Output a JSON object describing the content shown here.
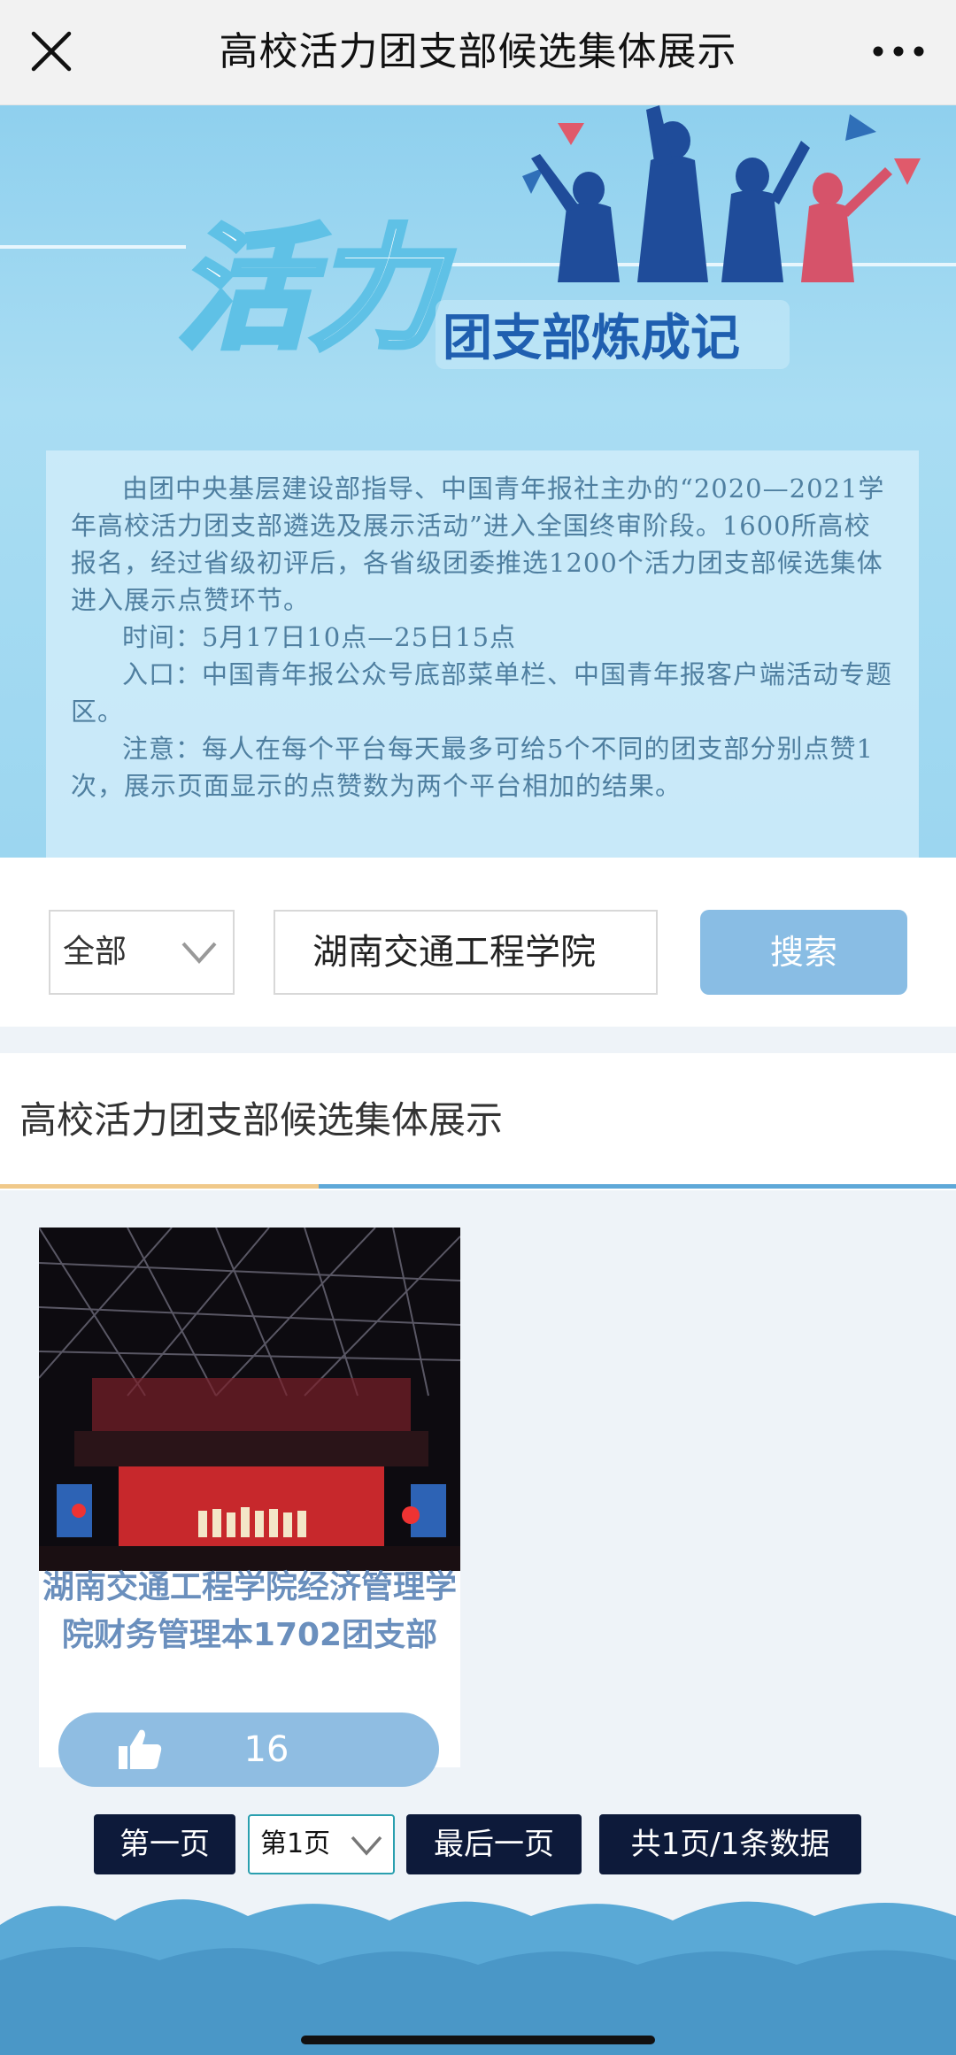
{
  "topbar": {
    "title": "高校活力团支部候选集体展示",
    "close_icon": "close-icon",
    "more_icon": "more-icon"
  },
  "banner": {
    "logo_main": "活力",
    "logo_sub": "团支部炼成记",
    "paragraphs": [
      "由团中央基层建设部指导、中国青年报社主办的“2020—2021学年高校活力团支部遴选及展示活动”进入全国终审阶段。1600所高校报名，经过省级初评后，各省级团委推选1200个活力团支部候选集体进入展示点赞环节。",
      "时间：5月17日10点—25日15点",
      "入口：中国青年报公众号底部菜单栏、中国青年报客户端活动专题区。",
      "注意：每人在每个平台每天最多可给5个不同的团支部分别点赞1次，展示页面显示的点赞数为两个平台相加的结果。"
    ]
  },
  "search": {
    "category_selected": "全部",
    "input_value": "湖南交通工程学院",
    "button_label": "搜索"
  },
  "section": {
    "heading": "高校活力团支部候选集体展示"
  },
  "results": [
    {
      "name": "湖南交通工程学院经济管理学院财务管理本1702团支部",
      "likes": "16"
    }
  ],
  "pagination": {
    "first_label": "第一页",
    "page_selected": "第1页",
    "last_label": "最后一页",
    "info": "共1页/1条数据"
  },
  "colors": {
    "search_button": "#89bde4",
    "like_button": "#8fbde2",
    "pager_bg": "#0d1a3a",
    "card_name": "#6a8fbd"
  }
}
